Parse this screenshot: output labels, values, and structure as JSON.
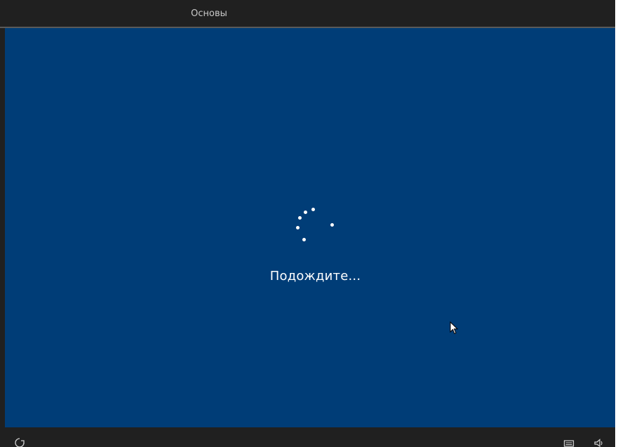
{
  "header": {
    "tabs": [
      {
        "label": "Основы",
        "active": true
      }
    ]
  },
  "main": {
    "status_text": "Подождите..."
  },
  "bottom_bar": {
    "icons": [
      "ease-of-access-icon",
      "keyboard-icon",
      "volume-icon"
    ]
  },
  "colors": {
    "background_blue": "#003d77",
    "bar_dark": "#202020",
    "text_white": "#ffffff",
    "tab_text": "#c8c8c8"
  }
}
